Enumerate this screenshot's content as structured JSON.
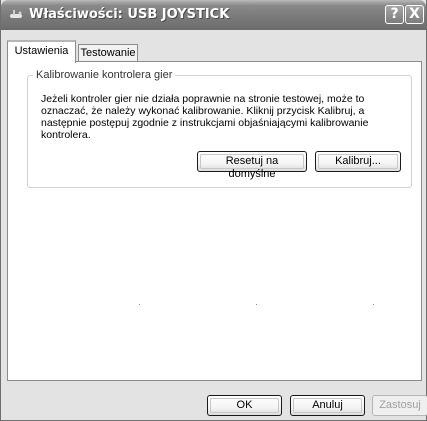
{
  "window": {
    "title": "Właściwości: USB JOYSTICK",
    "help_label": "?",
    "close_label": "X"
  },
  "tabs": [
    {
      "label": "Ustawienia",
      "active": true
    },
    {
      "label": "Testowanie",
      "active": false
    }
  ],
  "calibration": {
    "group_title": "Kalibrowanie kontrolera gier",
    "description": "Jeżeli kontroler gier nie działa poprawnie na stronie testowej, może to oznaczać, że należy wykonać kalibrowanie. Kliknij przycisk Kalibruj, a następnie postępuj zgodnie z instrukcjami objaśniającymi kalibrowanie kontrolera.",
    "reset_label": "Resetuj na domyślne",
    "calibrate_label": "Kalibruj..."
  },
  "footer": {
    "ok_label": "OK",
    "cancel_label": "Anuluj",
    "apply_label": "Zastosuj"
  },
  "colors": {
    "titlebar": "#7a7a7a",
    "face": "#e3e3e3",
    "panel": "#ffffff"
  }
}
